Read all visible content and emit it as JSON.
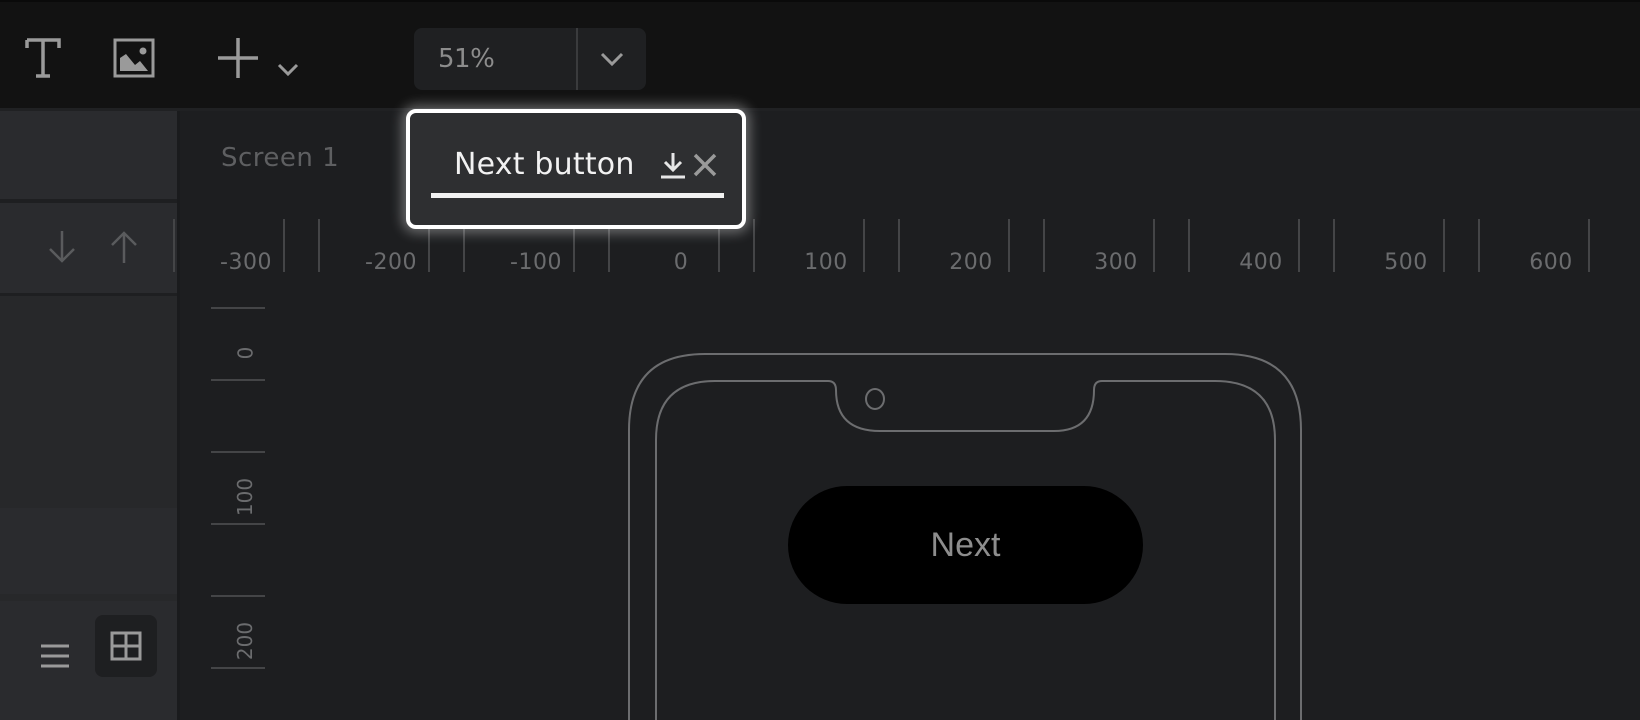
{
  "toolbar": {
    "tools": [
      {
        "name": "text-tool",
        "icon": "text-icon"
      },
      {
        "name": "image-tool",
        "icon": "image-icon"
      },
      {
        "name": "add-tool",
        "icon": "plus-icon",
        "dropdown_icon": "chevron-down-icon"
      }
    ],
    "zoom": {
      "value": "51%",
      "dropdown_icon": "chevron-down-icon"
    }
  },
  "sidebar": {
    "order_buttons": [
      {
        "name": "move-down",
        "icon": "arrow-down-icon"
      },
      {
        "name": "move-up",
        "icon": "arrow-up-icon"
      }
    ],
    "view_toggle": [
      {
        "name": "list-view",
        "icon": "list-icon",
        "active": false
      },
      {
        "name": "grid-view",
        "icon": "grid-icon",
        "active": true
      }
    ]
  },
  "canvas": {
    "screen_label": "Screen 1",
    "ruler_h": [
      "-300",
      "-200",
      "-100",
      "0",
      "100",
      "200",
      "300",
      "400",
      "500",
      "600"
    ],
    "ruler_v": [
      "0",
      "100",
      "200"
    ],
    "button_label": "Next"
  },
  "popup": {
    "title": "Next button",
    "download_icon": "download-icon",
    "close_icon": "close-icon"
  },
  "colors": {
    "toolbar_bg": "#121212",
    "sidebar_bg": "#2a2b2e",
    "canvas_bg": "#1d1e20",
    "popup_border": "#ffffff",
    "button_bg": "#000000"
  }
}
